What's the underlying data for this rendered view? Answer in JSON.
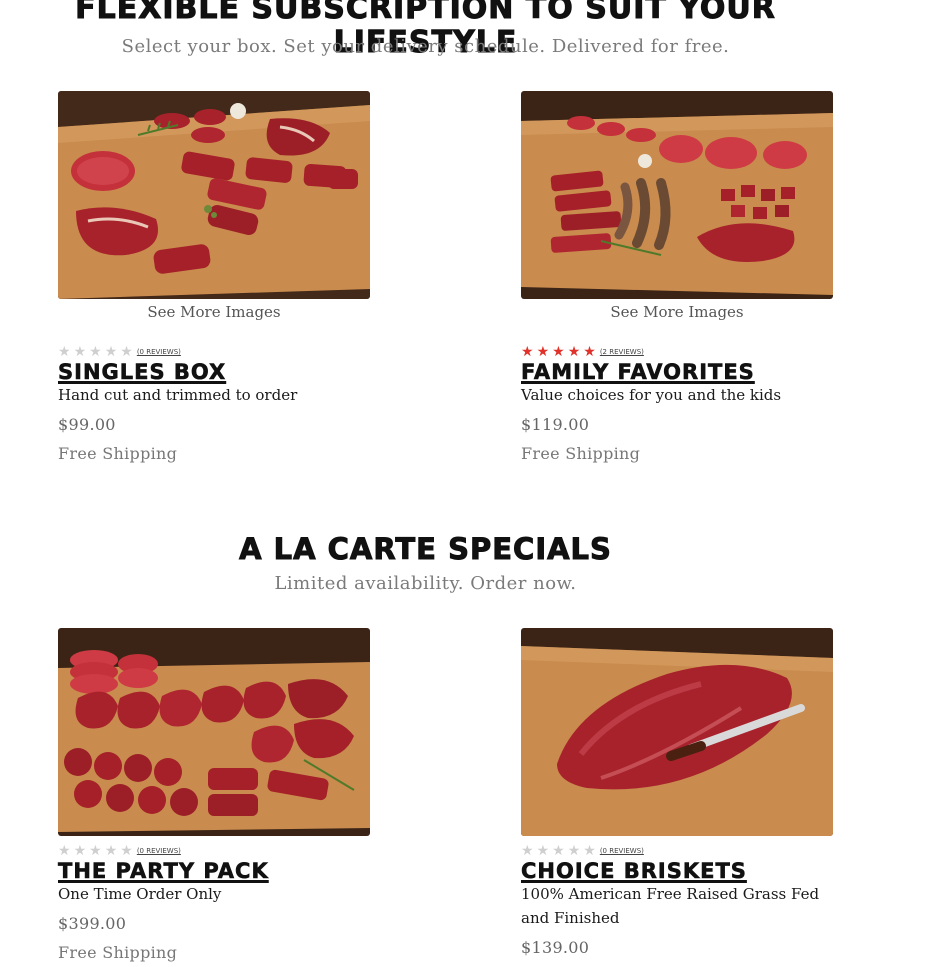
{
  "subscription": {
    "title": "Flexible Subscription to Suit Your Lifestyle",
    "subtitle": "Select your box. Set your delivery schedule. Delivered for free."
  },
  "specials": {
    "title": "A La Carte Specials",
    "subtitle": "Limited availability. Order now."
  },
  "products": [
    {
      "name": "Singles Box",
      "tagline": "Hand cut and trimmed to order",
      "price": "$99.00",
      "shipping": "Free Shipping",
      "see_more": "See More Images",
      "reviews": "(0 reviews)",
      "rating": 0
    },
    {
      "name": "Family Favorites",
      "tagline": "Value choices for you and the kids",
      "price": "$119.00",
      "shipping": "Free Shipping",
      "see_more": "See More Images",
      "reviews": "(2 reviews)",
      "rating": 5
    },
    {
      "name": "The Party Pack",
      "tagline": "One Time Order Only",
      "price": "$399.00",
      "shipping": "Free Shipping",
      "reviews": "(0 reviews)",
      "rating": 0
    },
    {
      "name": "Choice Briskets",
      "tagline": "100% American Free Raised Grass Fed and Finished",
      "price": "$139.00",
      "reviews": "(0 reviews)",
      "rating": 0
    }
  ],
  "colors": {
    "star_active": "#e0322b",
    "star_inactive": "#cfcfcf",
    "board": "#c98b4e",
    "background_wood": "#3b2416",
    "meat": "#b5282e"
  }
}
